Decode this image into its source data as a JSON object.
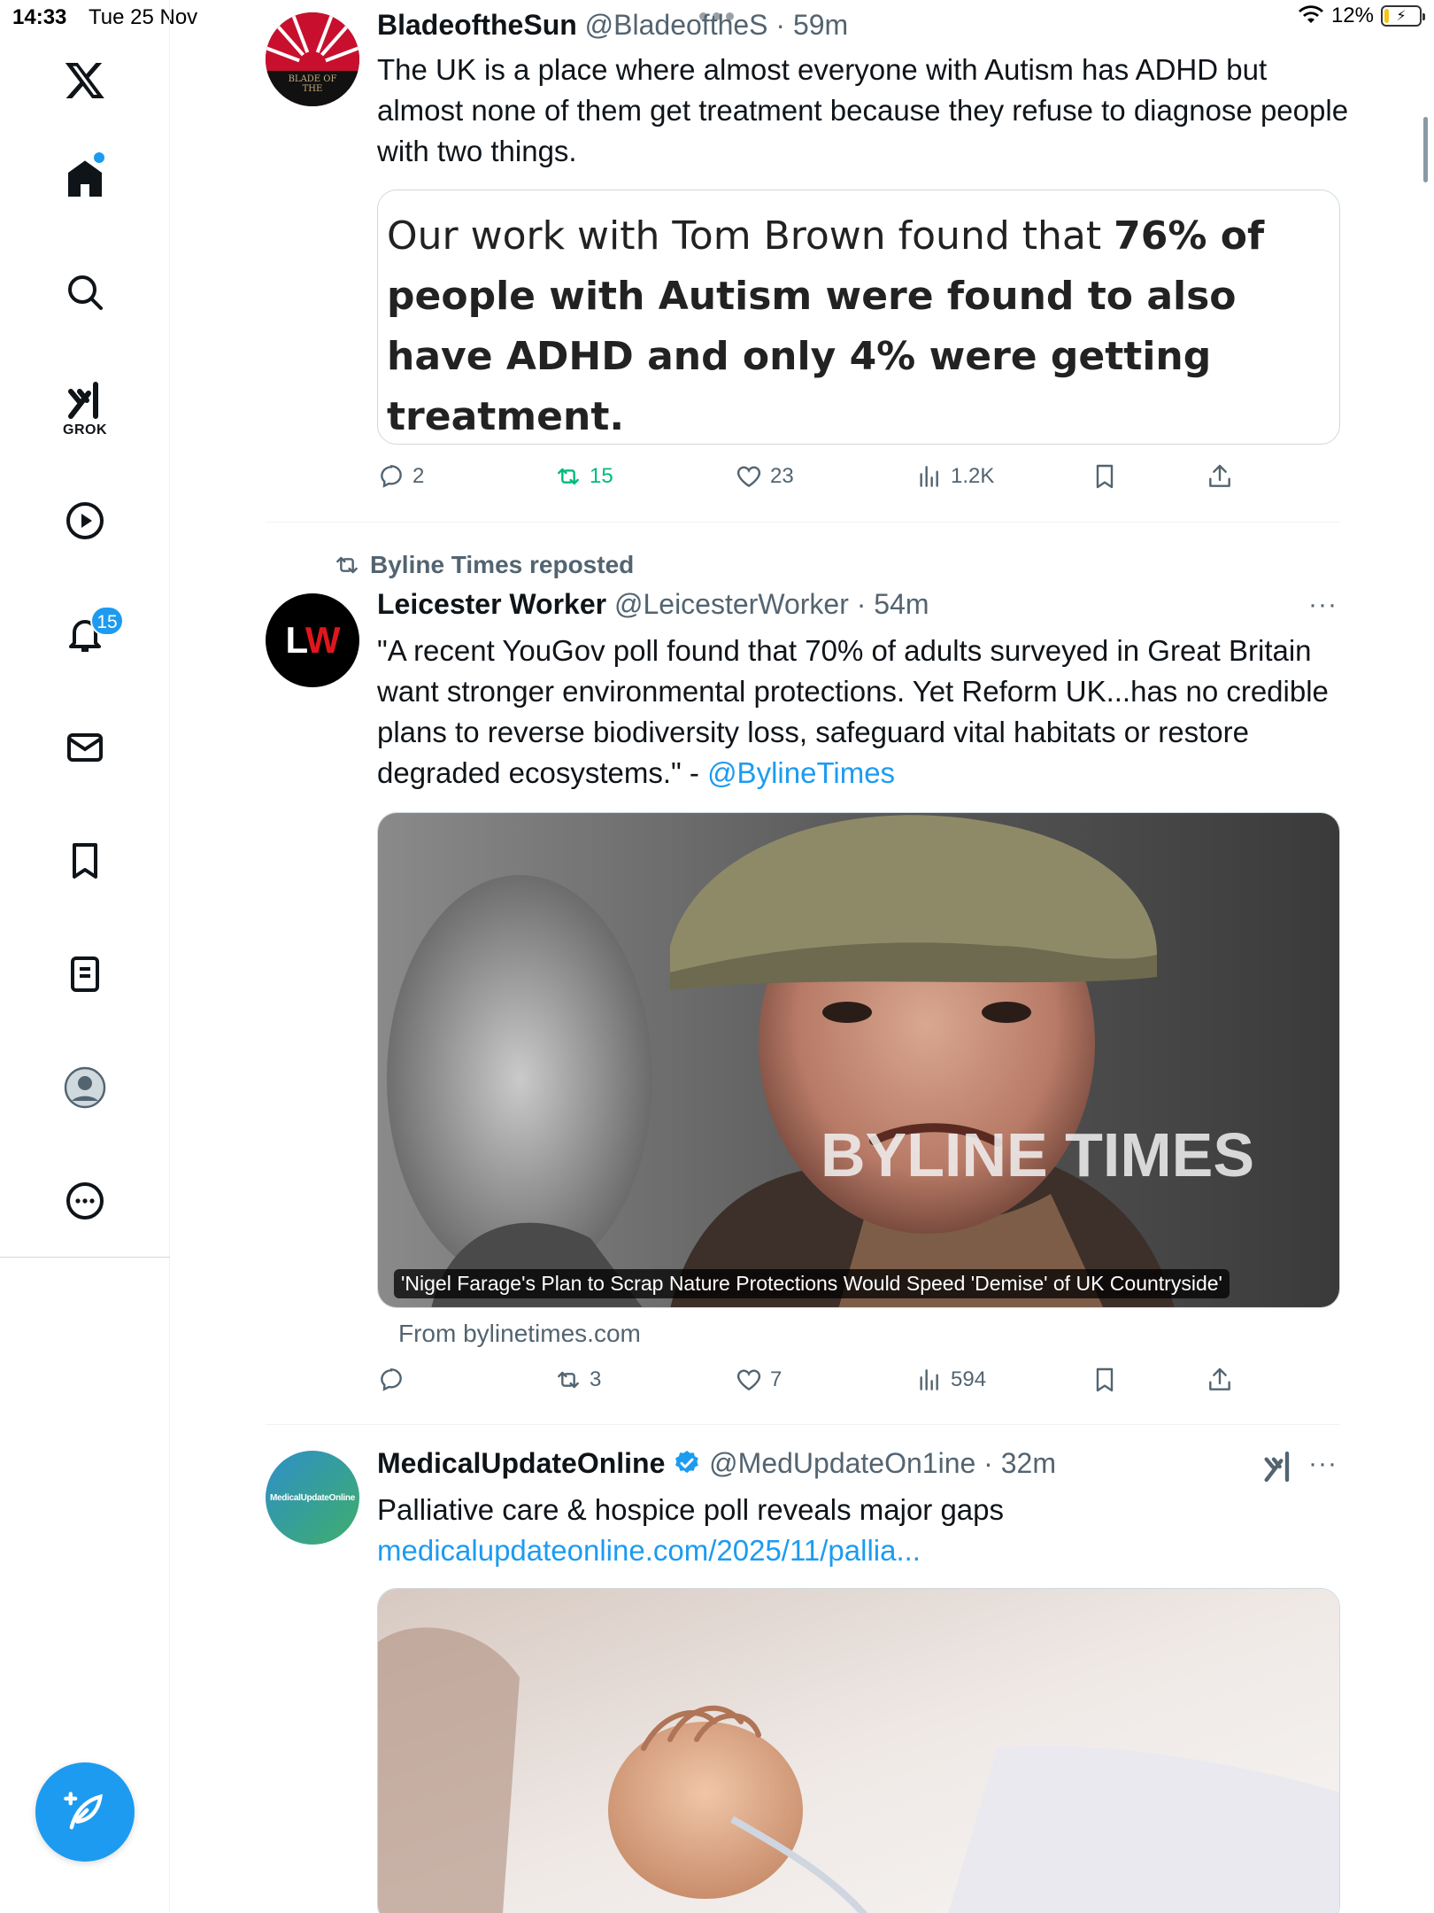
{
  "status": {
    "time": "14:33",
    "date": "Tue 25 Nov",
    "battery": "12%",
    "battery_level": 0.12
  },
  "sidebar": {
    "grok_label": "GROK",
    "notifications_badge": "15"
  },
  "tweets": [
    {
      "name": "BladeoftheSun",
      "handle": "@BladeoftheS",
      "time": "59m",
      "avatar_text": "BLADE OF THE",
      "text": "The UK is a place where almost everyone with Autism has ADHD but almost none of them get treatment because they refuse to diagnose people with two things.",
      "quote_plain": "Our work with Tom Brown found that ",
      "quote_bold": "76% of people with Autism were found to also have ADHD and only 4% were getting treatment.",
      "replies": "2",
      "reposts": "15",
      "likes": "23",
      "views": "1.2K"
    },
    {
      "reposted_by": "Byline Times reposted",
      "name": "Leicester Worker",
      "handle": "@LeicesterWorker",
      "time": "54m",
      "avatar_text": "LW",
      "text": "\"A recent YouGov poll found that 70% of adults surveyed in Great Britain want stronger environmental protections. Yet Reform UK...has no credible plans to reverse biodiversity loss, safeguard vital habitats or restore degraded ecosystems.\" - ",
      "mention": "@BylineTimes",
      "media_caption": "'Nigel Farage's Plan to Scrap Nature Protections Would Speed 'Demise' of UK Countryside'",
      "watermark": "BYLINE TIMES",
      "from": "From bylinetimes.com",
      "replies": "",
      "reposts": "3",
      "likes": "7",
      "views": "594"
    },
    {
      "name": "MedicalUpdateOnline",
      "handle": "@MedUpdateOn1ine",
      "time": "32m",
      "avatar_text": "MedicalUpdateOnline",
      "text": "Palliative care & hospice poll reveals major gaps",
      "link": "medicalupdateonline.com/2025/11/pallia..."
    }
  ],
  "colors": {
    "accent": "#1d9bf0",
    "repost_green": "#00ba7c",
    "meta_gray": "#536471"
  }
}
